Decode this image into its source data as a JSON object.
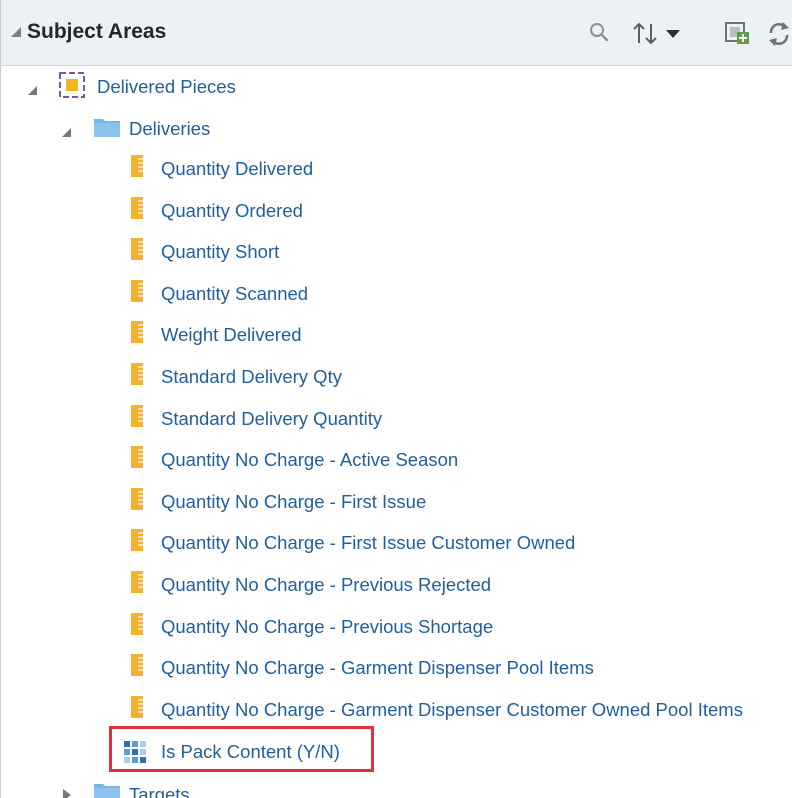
{
  "header": {
    "title": "Subject Areas",
    "icons": [
      "search-icon",
      "sort-icon",
      "add-subject-area-icon",
      "refresh-icon"
    ]
  },
  "tree": {
    "root": {
      "label": "Delivered Pieces",
      "icon": "subject-area-icon",
      "expanded": true
    },
    "folder": {
      "label": "Deliveries",
      "icon": "folder-icon",
      "expanded": true
    },
    "measures": [
      "Quantity Delivered",
      "Quantity Ordered",
      "Quantity Short",
      "Quantity Scanned",
      "Weight Delivered",
      "Standard Delivery Qty",
      "Standard Delivery Quantity",
      "Quantity No Charge - Active Season",
      "Quantity No Charge - First Issue",
      "Quantity No Charge - First Issue Customer Owned",
      "Quantity No Charge - Previous Rejected",
      "Quantity No Charge - Previous Shortage",
      "Quantity No Charge - Garment Dispenser Pool Items",
      "Quantity No Charge - Garment Dispenser Customer Owned Pool Items"
    ],
    "attribute": {
      "label": "Is Pack Content (Y/N)",
      "icon": "attribute-column-icon",
      "highlighted": true
    },
    "next_folder": {
      "label": "Targets",
      "icon": "folder-icon",
      "expanded": false
    }
  },
  "colors": {
    "link": "#1f5f9c",
    "measure_icon": "#f2b230",
    "folder": "#7ab4e3",
    "highlight": "#e0303a",
    "header_bg": "#eef1f4"
  }
}
